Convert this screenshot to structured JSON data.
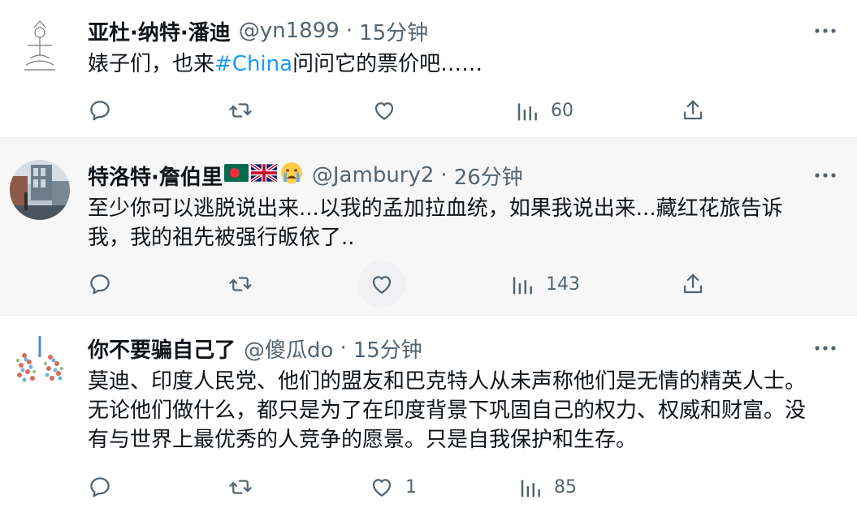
{
  "tweets": [
    {
      "name": "亚杜·纳特·潘迪",
      "handle": "@yn1899",
      "dot": "·",
      "time": "15分钟",
      "text_before": "婊子们，也来",
      "hashtag": "#China",
      "text_after": "问问它的票价吧……",
      "actions": {
        "reply": "",
        "retweet": "",
        "like": "",
        "views": "60"
      }
    },
    {
      "name": "特洛特·詹伯里",
      "flags": [
        "bangladesh-flag",
        "uk-flag",
        "crying-face-emoji"
      ],
      "handle": "@Jambury2",
      "dot": "·",
      "time": "26分钟",
      "lines": [
        "至少你可以逃脱说出来...以我的孟加拉血统，如果我说出来...藏红花旅告诉",
        "我，我的祖先被强行皈依了.."
      ],
      "actions": {
        "reply": "",
        "retweet": "",
        "like": "",
        "views": "143"
      }
    },
    {
      "name": "你不要骗自己了",
      "handle": "@傻瓜do",
      "dot": "·",
      "time": "15分钟",
      "lines": [
        "莫迪、印度人民党、他们的盟友和巴克特人从未声称他们是无情的精英人士。",
        "无论他们做什么，都只是为了在印度背景下巩固自己的权力、权威和财富。没",
        "有与世界上最优秀的人竞争的愿景。只是自我保护和生存。"
      ],
      "actions": {
        "reply": "",
        "retweet": "",
        "like": "1",
        "views": "85"
      }
    }
  ],
  "colors": {
    "link": "#1d9bf0",
    "secondary_text": "#536471",
    "primary_text": "#0f1419",
    "hover_background": "#f7f7f7"
  }
}
